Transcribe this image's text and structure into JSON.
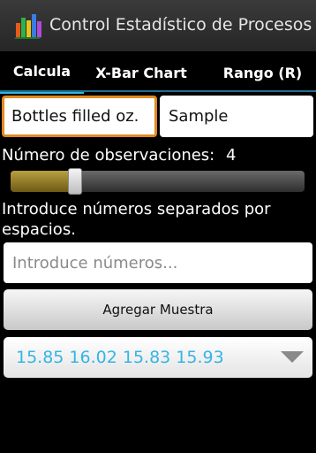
{
  "app": {
    "title": "Control Estadístico de Procesos",
    "icon": "bar-chart-icon"
  },
  "tabs": [
    {
      "label": "Calcula",
      "active": true
    },
    {
      "label": "X-Bar Chart",
      "active": false
    },
    {
      "label": "Rango (R)",
      "active": false
    }
  ],
  "form": {
    "variable_name": "Bottles filled oz.",
    "sample_name": "Sample",
    "observations_label": "Número de observaciones:",
    "observations_value": "4",
    "slider_fraction": 0.22,
    "instructions": "Introduce números separados por espacios.",
    "numbers_placeholder": "Introduce números...",
    "add_button_label": "Agregar Muestra",
    "samples_selected": "15.85 16.02 15.83 15.93"
  },
  "colors": {
    "accent": "#33b5e5",
    "focus": "#e08a1e",
    "slider_fill": "#b8a040",
    "background": "#000000"
  }
}
